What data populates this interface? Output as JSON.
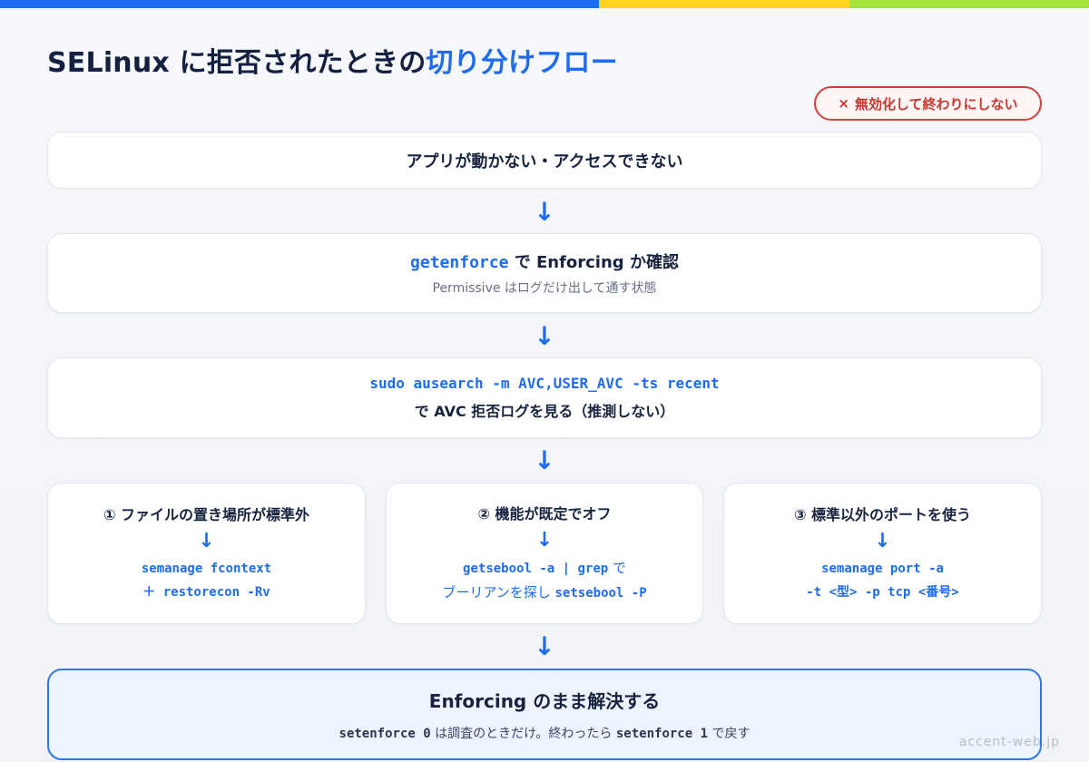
{
  "title": {
    "prefix": "SELinux に拒否されたときの",
    "accent": "切り分けフロー"
  },
  "warning_badge": {
    "icon": "×",
    "label": "無効化して終わりにしない"
  },
  "steps": [
    {
      "text": "アプリが動かない・アクセスできない"
    },
    {
      "command": "getenforce",
      "text": " で Enforcing か確認",
      "sub": "Permissive はログだけ出して通す状態"
    },
    {
      "command": "sudo ausearch -m AVC,USER_AVC -ts recent",
      "text": "で AVC 拒否ログを見る（推測しない）"
    }
  ],
  "arrow_glyph": "↓",
  "branches": [
    {
      "title": "① ファイルの置き場所が標準外",
      "line1": "semanage fcontext",
      "line2": "＋ restorecon -Rv"
    },
    {
      "title": "② 機能が既定でオフ",
      "line1_code": "getsebool -a | grep",
      "line1_text": " で",
      "line2_text": "ブーリアンを探し ",
      "line2_code": "setsebool -P"
    },
    {
      "title": "③ 標準以外のポートを使う",
      "line1": "semanage port -a",
      "line2": "-t <型> -p tcp <番号>"
    }
  ],
  "final": {
    "title": "Enforcing のまま解決する",
    "code1": "setenforce 0",
    "text1": " は調査のときだけ。終わったら ",
    "code2": "setenforce 1",
    "text2": " で戻す"
  },
  "watermark": "accent-web.jp",
  "colors": {
    "accent": "#1e6cf2",
    "warning": "#d4413a",
    "topbar": [
      "#1e6cf2",
      "#ffd21f",
      "#a6e23a"
    ]
  }
}
